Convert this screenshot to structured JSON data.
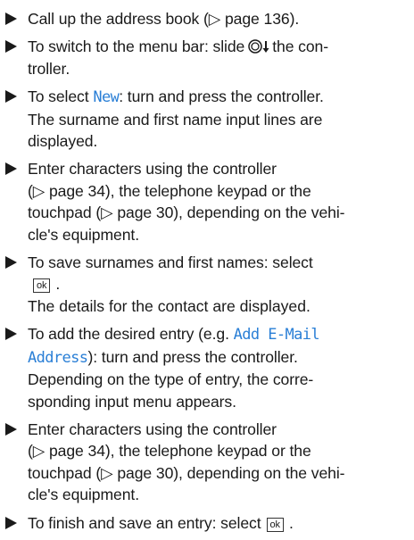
{
  "steps": [
    {
      "lines": [
        "Call up the address book (▷ page 136)."
      ]
    },
    {
      "a": "To switch to the menu bar: slide",
      "b": "the con-",
      "line2": "troller."
    },
    {
      "a": "To select",
      "hl": "New",
      "b": ": turn and press the controller.",
      "lines": [
        "The surname and first name input lines are",
        "displayed."
      ]
    },
    {
      "lines": [
        "Enter characters using the controller",
        "(▷ page 34), the telephone keypad or the",
        "touchpad (▷ page 30), depending on the vehi-",
        "cle's equipment."
      ]
    },
    {
      "line1": "To save surnames and first names: select",
      "key": "ok",
      "end": ".",
      "note": "The details for the contact are displayed."
    },
    {
      "a": "To add the desired entry (e.g.",
      "hl1": "Add E-Mail",
      "hl2": "Address",
      "b": "): turn and press the controller.",
      "lines": [
        "Depending on the type of entry, the corre-",
        "sponding input menu appears."
      ]
    },
    {
      "lines": [
        "Enter characters using the controller",
        "(▷ page 34), the telephone keypad or the",
        "touchpad (▷ page 30), depending on the vehi-",
        "cle's equipment."
      ]
    },
    {
      "a": "To finish and save an entry: select",
      "key": "ok",
      "end": "."
    }
  ],
  "icons": {
    "bullet": "right-triangle-bullet",
    "controller": "controller-slide-down-icon"
  },
  "colors": {
    "highlight": "#2a7fd6",
    "text": "#1a1a1a"
  }
}
